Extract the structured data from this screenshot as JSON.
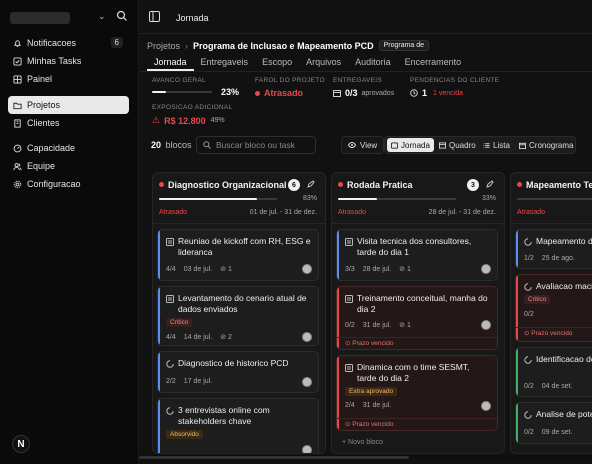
{
  "sidebar": {
    "items": [
      {
        "label": "Notificacoes",
        "count": "6",
        "icon": "bell-icon"
      },
      {
        "label": "Minhas Tasks",
        "icon": "check-square-icon"
      },
      {
        "label": "Painel",
        "icon": "grid-icon"
      },
      {
        "label": "Projetos",
        "icon": "folder-icon",
        "active": true
      },
      {
        "label": "Clientes",
        "icon": "building-icon"
      },
      {
        "label": "Capacidade",
        "icon": "gauge-icon"
      },
      {
        "label": "Equipe",
        "icon": "users-icon"
      },
      {
        "label": "Configuracao",
        "icon": "gear-icon"
      }
    ],
    "logo": "N"
  },
  "topbar": {
    "title": "Jornada"
  },
  "breadcrumb": {
    "root": "Projetos",
    "project": "Programa de Inclusao e Mapeamento PCD",
    "tag": "Programa de"
  },
  "tabs": [
    "Jornada",
    "Entregaveis",
    "Escopo",
    "Arquivos",
    "Auditoria",
    "Encerramento"
  ],
  "stats": {
    "avanco": {
      "label": "AVANCO GERAL",
      "value": "23%",
      "progress": 0.23
    },
    "farol": {
      "label": "FAROL DO PROJETO",
      "value": "Atrasado"
    },
    "entregaveis": {
      "label": "ENTREGAVEIS",
      "value": "0/3",
      "sub": "aprovados"
    },
    "pendencias": {
      "label": "PENDENCIAS DO CLIENTE",
      "value": "1",
      "sub": "1 vencida"
    },
    "exposicao": {
      "label": "EXPOSICAO ADICIONAL",
      "value": "R$ 12.800",
      "sub": "49%"
    }
  },
  "toolbar": {
    "count": "20",
    "count_label": "blocos",
    "search_placeholder": "Buscar bloco ou task",
    "view": "View",
    "modes": [
      "Jornada",
      "Quadro",
      "Lista",
      "Cronograma"
    ]
  },
  "columns": [
    {
      "name": "Diagnostico Organizacional",
      "badge": "6",
      "pct": "83%",
      "progress": 0.83,
      "status": "Atrasado",
      "dates": "01 de jul. - 31 de dez.",
      "cards": [
        {
          "title": "Reuniao de kickoff com RH, ESG e lideranca",
          "icon": "doc-icon",
          "checks": "4/4",
          "date": "03 de jul.",
          "att": "1",
          "bar": "#5b8def"
        },
        {
          "title": "Levantamento do cenario atual de dados enviados",
          "icon": "doc-icon",
          "chip": "Critico",
          "checks": "4/4",
          "date": "14 de jul.",
          "att": "2",
          "bar": "#5b8def"
        },
        {
          "title": "Diagnostico de historico PCD",
          "icon": "loader-icon",
          "checks": "2/2",
          "date": "17 de jul.",
          "bar": "#5b8def"
        },
        {
          "title": "3 entrevistas online com stakeholders chave",
          "icon": "loader-icon",
          "chip": "Absorvido",
          "bar": "#5b8def"
        }
      ]
    },
    {
      "name": "Rodada Pratica",
      "badge": "3",
      "pct": "33%",
      "progress": 0.33,
      "status": "Atrasado",
      "dates": "28 de jul. - 31 de dez.",
      "cards": [
        {
          "title": "Visita tecnica dos consultores, tarde do dia 1",
          "icon": "doc-icon",
          "checks": "3/3",
          "date": "28 de jul.",
          "att": "1",
          "bar": "#5b8def"
        },
        {
          "title": "Treinamento conceitual, manha do dia 2",
          "icon": "doc-icon",
          "checks": "0/2",
          "date": "31 de jul.",
          "att": "1",
          "bar": "#e5484d",
          "warn": "Prazo vencido"
        },
        {
          "title": "Dinamica com o time SESMT, tarde do dia 2",
          "icon": "doc-icon",
          "chip": "Extra aprovado",
          "checks": "2/4",
          "date": "31 de jul.",
          "bar": "#e5484d",
          "warn": "Prazo vencido"
        }
      ],
      "new": "+ Novo bloco"
    },
    {
      "name": "Mapeamento Tecnico",
      "status": "Atrasado",
      "cards": [
        {
          "title": "Mapeamento de",
          "icon": "loader-icon",
          "checks": "1/2",
          "date": "25 de ago.",
          "bar": "#5b8def"
        },
        {
          "title": "Avaliacao macro",
          "icon": "loader-icon",
          "chip": "Critico",
          "checks": "0/2",
          "date": "",
          "bar": "#e5484d",
          "warn": "Prazo vencido"
        },
        {
          "title": "Identificacao de operacionais",
          "icon": "loader-icon",
          "checks": "0/2",
          "date": "04 de set.",
          "bar": "#3fb068"
        },
        {
          "title": "Analise de pote",
          "icon": "loader-icon",
          "checks": "0/2",
          "date": "09 de set.",
          "bar": "#3fb068"
        }
      ]
    }
  ]
}
